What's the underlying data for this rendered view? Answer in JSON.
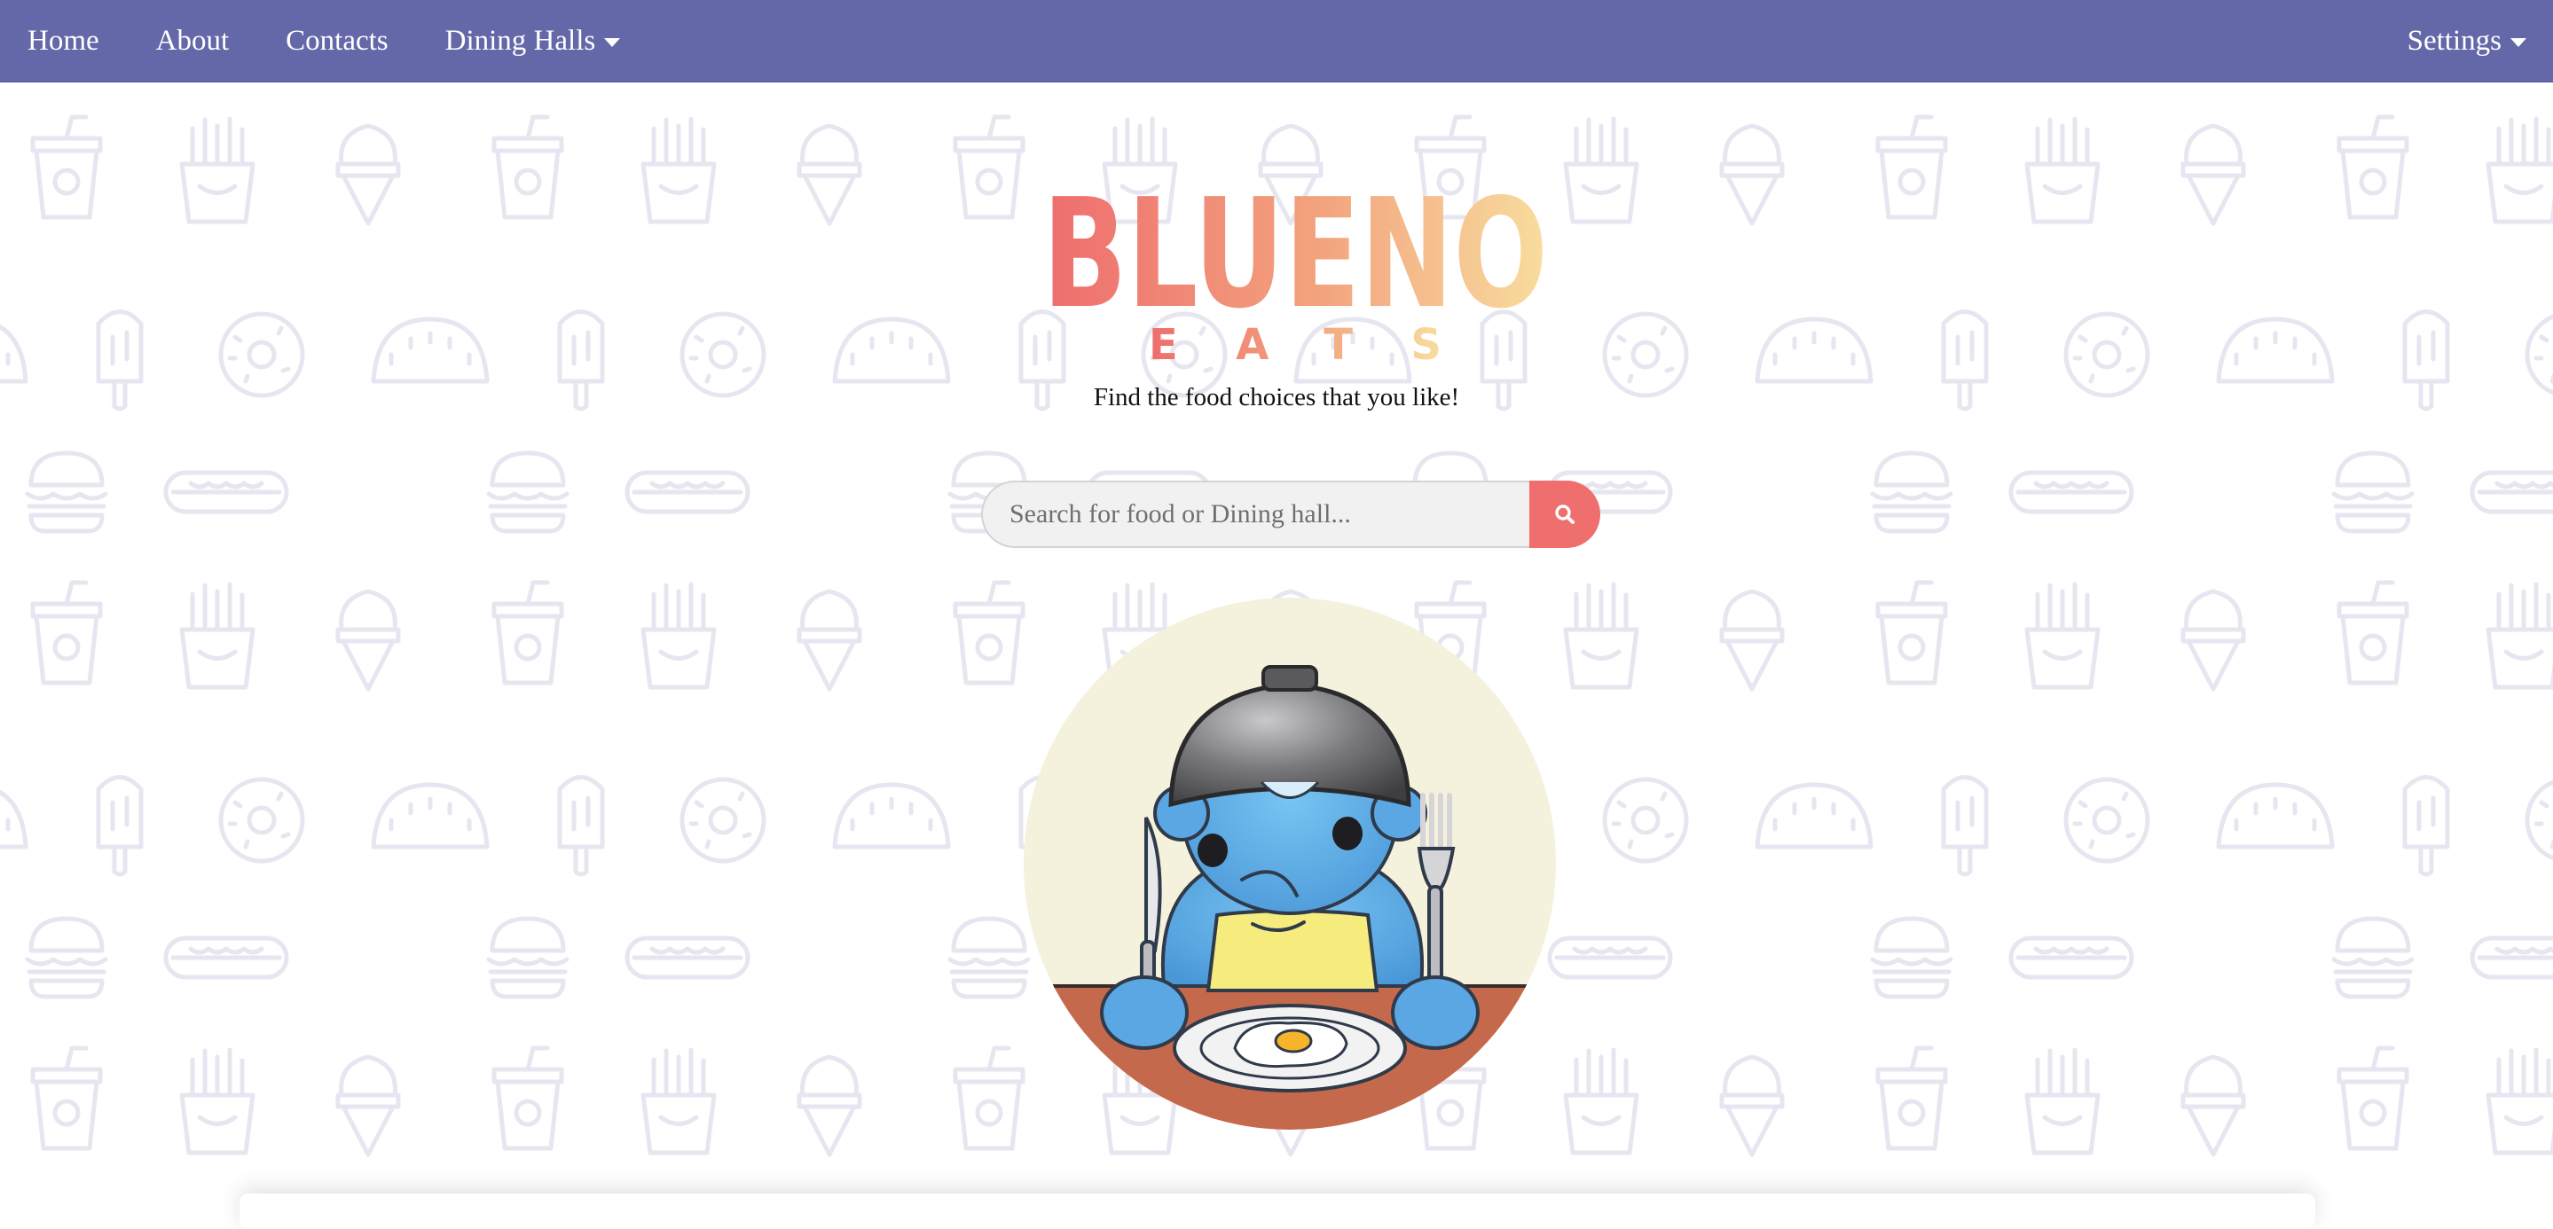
{
  "nav": {
    "home": "Home",
    "about": "About",
    "contacts": "Contacts",
    "dining_halls": "Dining Halls",
    "settings": "Settings"
  },
  "logo": {
    "line1": "BLUENO",
    "line2": "EATS"
  },
  "tagline": "Find the food choices that you like!",
  "search": {
    "placeholder": "Search for food or Dining hall...",
    "button_icon": "search-icon"
  },
  "colors": {
    "navbar": "#6568a8",
    "accent": "#ef6f6e",
    "logo_gradient_start": "#ee6d6e",
    "logo_gradient_end": "#f8db9c",
    "background_pattern": "#e9e9f3"
  },
  "background_icons": [
    "drink-cup-icon",
    "ice-cream-cone-icon",
    "fries-icon",
    "popsicle-icon",
    "donut-icon",
    "taco-icon",
    "burger-icon",
    "hot-dog-icon"
  ],
  "mascot_icon": "bear-eating-breakfast-illustration"
}
